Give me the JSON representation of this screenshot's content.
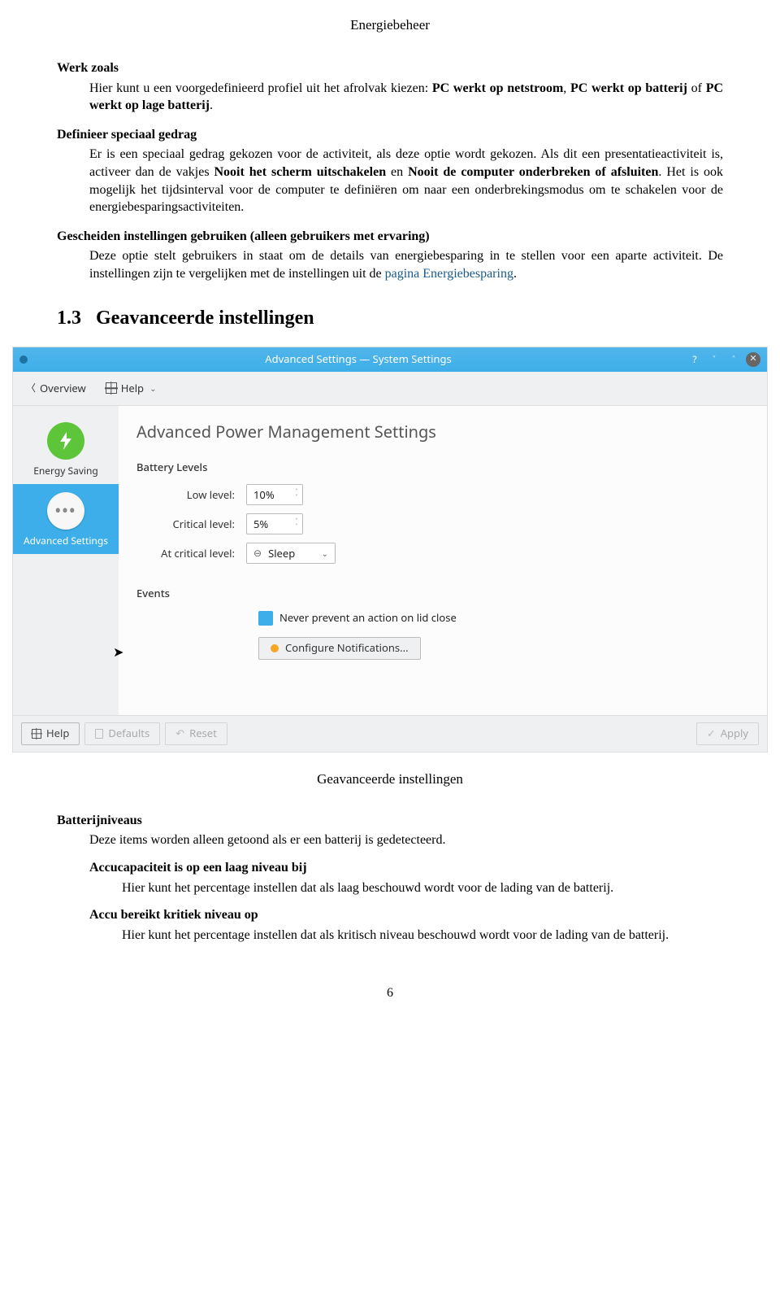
{
  "doc": {
    "header": "Energiebeheer",
    "page_number": "6"
  },
  "sections": {
    "werk_zoals": {
      "title": "Werk zoals",
      "body_prefix": "Hier kunt u een voorgedefinieerd profiel uit het afrolvak kiezen: ",
      "opt1": "PC werkt op netstroom",
      "sep1": ", ",
      "opt2": "PC werkt op batterij",
      "sep2": " of ",
      "opt3": "PC werkt op lage batterij",
      "body_suffix": "."
    },
    "def_gedrag": {
      "title": "Definieer speciaal gedrag",
      "p1_a": "Er is een speciaal gedrag gekozen voor de activiteit, als deze optie wordt gekozen. Als dit een presentatieactiviteit is, activeer dan de vakjes ",
      "p1_b": "Nooit het scherm uitschakelen",
      "p1_c": " en ",
      "p1_d": "Nooit de computer onderbreken of afsluiten",
      "p1_e": ". Het is ook mogelijk het tijdsinterval voor de computer te definiëren om naar een onderbrekingsmodus om te schakelen voor de energiebesparingsactiviteiten."
    },
    "gescheiden": {
      "title": "Gescheiden instellingen gebruiken (alleen gebruikers met ervaring)",
      "body_a": "Deze optie stelt gebruikers in staat om de details van energiebesparing in te stellen voor een aparte activiteit. De instellingen zijn te vergelijken met de instellingen uit de ",
      "link": "pagina Energiebesparing",
      "body_b": "."
    },
    "h2_num": "1.3",
    "h2_text": "Geavanceerde instellingen"
  },
  "screenshot": {
    "titlebar": "Advanced Settings — System Settings",
    "toolbar": {
      "overview": "Overview",
      "help": "Help"
    },
    "sidebar": {
      "energy": "Energy Saving",
      "advanced": "Advanced Settings"
    },
    "main": {
      "title": "Advanced Power Management Settings",
      "battery_levels": "Battery Levels",
      "low_level_label": "Low level:",
      "low_level_value": "10%",
      "critical_level_label": "Critical level:",
      "critical_level_value": "5%",
      "at_critical_label": "At critical level:",
      "at_critical_value": "Sleep",
      "events_label": "Events",
      "checkbox_label": "Never prevent an action on lid close",
      "configure_btn": "Configure Notifications..."
    },
    "footer": {
      "help": "Help",
      "defaults": "Defaults",
      "reset": "Reset",
      "apply": "Apply"
    }
  },
  "figcaption": "Geavanceerde instellingen",
  "post": {
    "batterij_title": "Batterijniveaus",
    "batterij_body": "Deze items worden alleen getoond als er een batterij is gedetecteerd.",
    "accu_laag_title": "Accucapaciteit is op een laag niveau bij",
    "accu_laag_body": "Hier kunt het percentage instellen dat als laag beschouwd wordt voor de lading van de batterij.",
    "accu_kritiek_title": "Accu bereikt kritiek niveau op",
    "accu_kritiek_body": "Hier kunt het percentage instellen dat als kritisch niveau beschouwd wordt voor de lading van de batterij."
  }
}
